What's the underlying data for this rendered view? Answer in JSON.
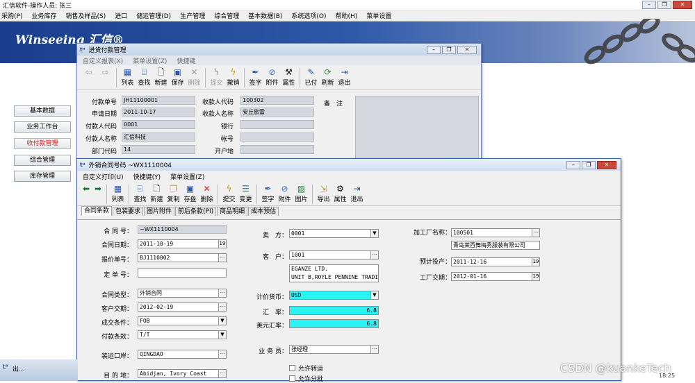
{
  "app": {
    "title": "汇信软件-操作人员: 张三",
    "logo": "Winseeing 汇信®"
  },
  "top_menu": [
    "采购(P)",
    "业务库存",
    "销售及样品(S)",
    "进口",
    "储运管理(D)",
    "生产管理",
    "综合管理",
    "基本数据(B)",
    "系统选项(O)",
    "帮助(H)",
    "菜单设置"
  ],
  "nav": [
    "基本数据",
    "业务工作台",
    "收付款管理",
    "综合管理",
    "库存管理"
  ],
  "payment_window": {
    "title": "进货付款管理",
    "menu": [
      "自定义报表(X)",
      "菜单设置(Z)",
      "快捷键"
    ],
    "toolbar": [
      "列表",
      "查找",
      "新建",
      "保存",
      "删除",
      "提交",
      "撤销",
      "签字",
      "附件",
      "属性",
      "已付",
      "刷新",
      "退出"
    ],
    "fields": {
      "pay_no": {
        "label": "付款单号",
        "value": "JH11100001"
      },
      "apply_date": {
        "label": "申请日期",
        "value": "2011-10-17"
      },
      "payer_code": {
        "label": "付款人代码",
        "value": "0001"
      },
      "payer_name": {
        "label": "付款人名称",
        "value": "汇信科技"
      },
      "dept_code": {
        "label": "部门代码",
        "value": "14"
      },
      "payee_code": {
        "label": "收款人代码",
        "value": "100302"
      },
      "payee_name": {
        "label": "收款人名称",
        "value": "安丘旅雷"
      },
      "bank": {
        "label": "银行",
        "value": ""
      },
      "account": {
        "label": "帐号",
        "value": ""
      },
      "branch": {
        "label": "开户地",
        "value": ""
      },
      "remark": {
        "label": "备　注",
        "value": ""
      }
    }
  },
  "contract_window": {
    "title": "外销合同号码 ~WX1110004",
    "menu": [
      "自定义打印(U)",
      "快捷键(Y)",
      "菜单设置(Z)"
    ],
    "toolbar": [
      "列表",
      "查找",
      "新建",
      "复制",
      "存盘",
      "删除",
      "提交",
      "变更",
      "签字",
      "附件",
      "图片",
      "导出",
      "属性",
      "退出"
    ],
    "tabs": [
      "合同条款",
      "包装要求",
      "图片附件",
      "前后条款(PI)",
      "商品明细",
      "成本预估"
    ],
    "left": {
      "contract_no": {
        "label": "合 同 号：",
        "value": "~WX1110004"
      },
      "contract_date": {
        "label": "合同日期：",
        "value": "2011-10-19"
      },
      "quote_no": {
        "label": "报价单号：",
        "value": "BJ1110002"
      },
      "order_no": {
        "label": "定 单 号：",
        "value": ""
      },
      "contract_type": {
        "label": "合同类型：",
        "value": "外销合同"
      },
      "customer_due": {
        "label": "客户交期：",
        "value": "2012-02-19"
      },
      "deal_terms": {
        "label": "成交条件：",
        "value": "FOB"
      },
      "pay_terms": {
        "label": "付款条款：",
        "value": "T/T"
      },
      "port": {
        "label": "装运口岸：",
        "value": "QINGDAO"
      },
      "destination": {
        "label": "目 的 地：",
        "value": "Abidjan, Ivory Coast"
      }
    },
    "middle": {
      "seller": {
        "label": "卖　方：",
        "value": "0001"
      },
      "buyer": {
        "label": "客　户：",
        "value": "1001"
      },
      "buyer_address_1": "EGANZE LTD.",
      "buyer_address_2": "UNIT B,ROYLE PENNINE TRADING",
      "currency": {
        "label": "计价货币：",
        "value": "USD"
      },
      "rate": {
        "label": "汇　率：",
        "value": "6.8"
      },
      "usd_rate": {
        "label": "美元汇率：",
        "value": "6.8"
      },
      "salesman": {
        "label": "业 务 员：",
        "value": "张经理"
      },
      "allow_transship": "允许转运",
      "allow_partial": "允许分批"
    },
    "right": {
      "factory": {
        "label": "加工厂名称：",
        "value": "100501",
        "name": "青岛莱西舞梅秀服装有限公司"
      },
      "planned_start": {
        "label": "预计投产：",
        "value": "2011-12-16"
      },
      "factory_due": {
        "label": "工厂交期：",
        "value": "2012-01-16"
      }
    }
  },
  "taskbar": {
    "item": "出..."
  },
  "watermark": "CSDN @kuankeTech",
  "clock": "18:25",
  "colors": {
    "banner": "#2d59a8",
    "highlight": "#2cf3f3",
    "active_nav": "#d21b1b"
  }
}
